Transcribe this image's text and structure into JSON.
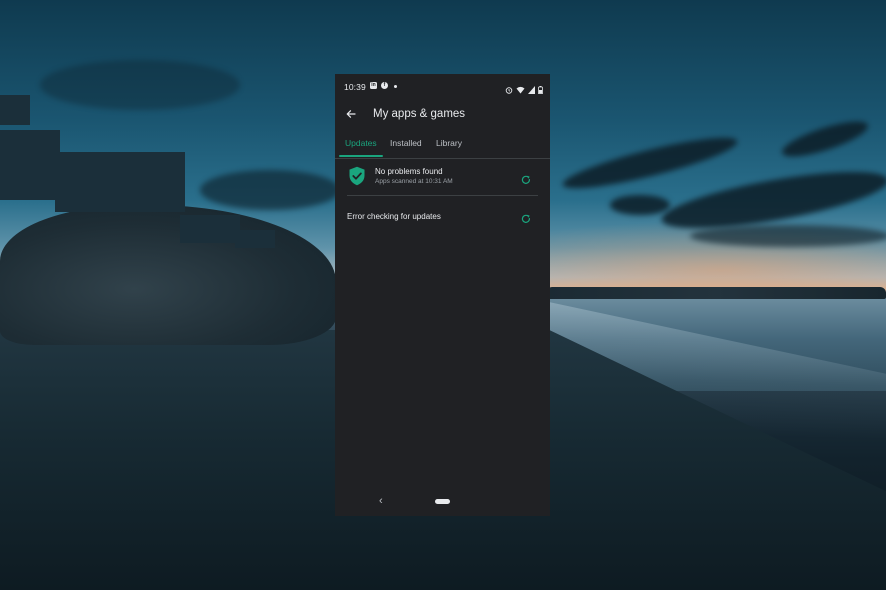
{
  "status_bar": {
    "time": "10:39",
    "left_icons": [
      "linkedin-icon",
      "facebook-icon",
      "notification-dot-icon"
    ],
    "right_icons": [
      "alarm-icon",
      "wifi-icon",
      "signal-icon",
      "battery-icon"
    ]
  },
  "header": {
    "title": "My apps & games",
    "back_icon": "arrow-back-icon"
  },
  "tabs": [
    {
      "label": "Updates",
      "active": true
    },
    {
      "label": "Installed",
      "active": false
    },
    {
      "label": "Library",
      "active": false
    }
  ],
  "play_protect": {
    "icon": "shield-check-icon",
    "title": "No problems found",
    "subtitle": "Apps scanned at 10:31 AM",
    "action_icon": "refresh-icon"
  },
  "update_status": {
    "text": "Error checking for updates",
    "action_icon": "refresh-icon"
  },
  "nav": {
    "back_glyph": "‹"
  },
  "colors": {
    "accent": "#1aa57e",
    "surface": "#202124",
    "text": "#e8eaed",
    "secondary_text": "#9aa0a6"
  }
}
